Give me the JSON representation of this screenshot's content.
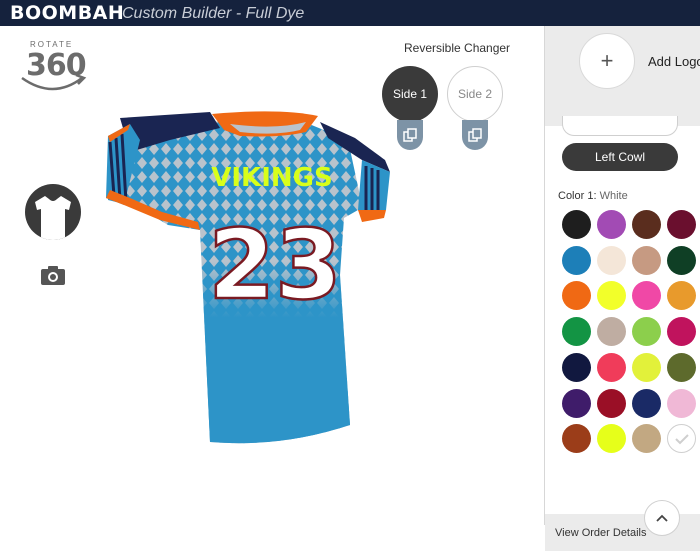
{
  "header": {
    "brand": "BOOMBAH",
    "title": "Custom Builder - Full Dye"
  },
  "viewer": {
    "rotate_label": "ROTATE",
    "rotate_value": "360",
    "reversible_label": "Reversible Changer",
    "side1_label": "Side 1",
    "side2_label": "Side 2",
    "jersey": {
      "team_text": "VIKINGS",
      "number": "23"
    }
  },
  "panel": {
    "add_logos_label": "Add Logos,",
    "collar_button": "Left Cowl",
    "color_label": "Color 1:",
    "color_value": "White",
    "swatches": [
      "#1e1e1e",
      "#a24bb4",
      "#5a2d1e",
      "#6a0f2e",
      "#1d7fb8",
      "#f4e6d8",
      "#c69a82",
      "#0f3f25",
      "#f06914",
      "#f2ff2a",
      "#f048a6",
      "#e89a2c",
      "#139444",
      "#bfada2",
      "#8ccf4c",
      "#c0135d",
      "#11183f",
      "#f03c5a",
      "#e2f13a",
      "#5d6a2c",
      "#3f1c6a",
      "#9a0f26",
      "#1a2a66",
      "#f0b8d6",
      "#9b3d19",
      "#e6ff1a",
      "#c2a882",
      "#ffffff"
    ],
    "order_details": "View Order Details"
  },
  "colors": {
    "header_bg": "#15223d",
    "jersey_body": "#2d94c8",
    "jersey_navy": "#1a2552",
    "jersey_orange": "#f06914",
    "team_text": "#d8ff1a"
  }
}
